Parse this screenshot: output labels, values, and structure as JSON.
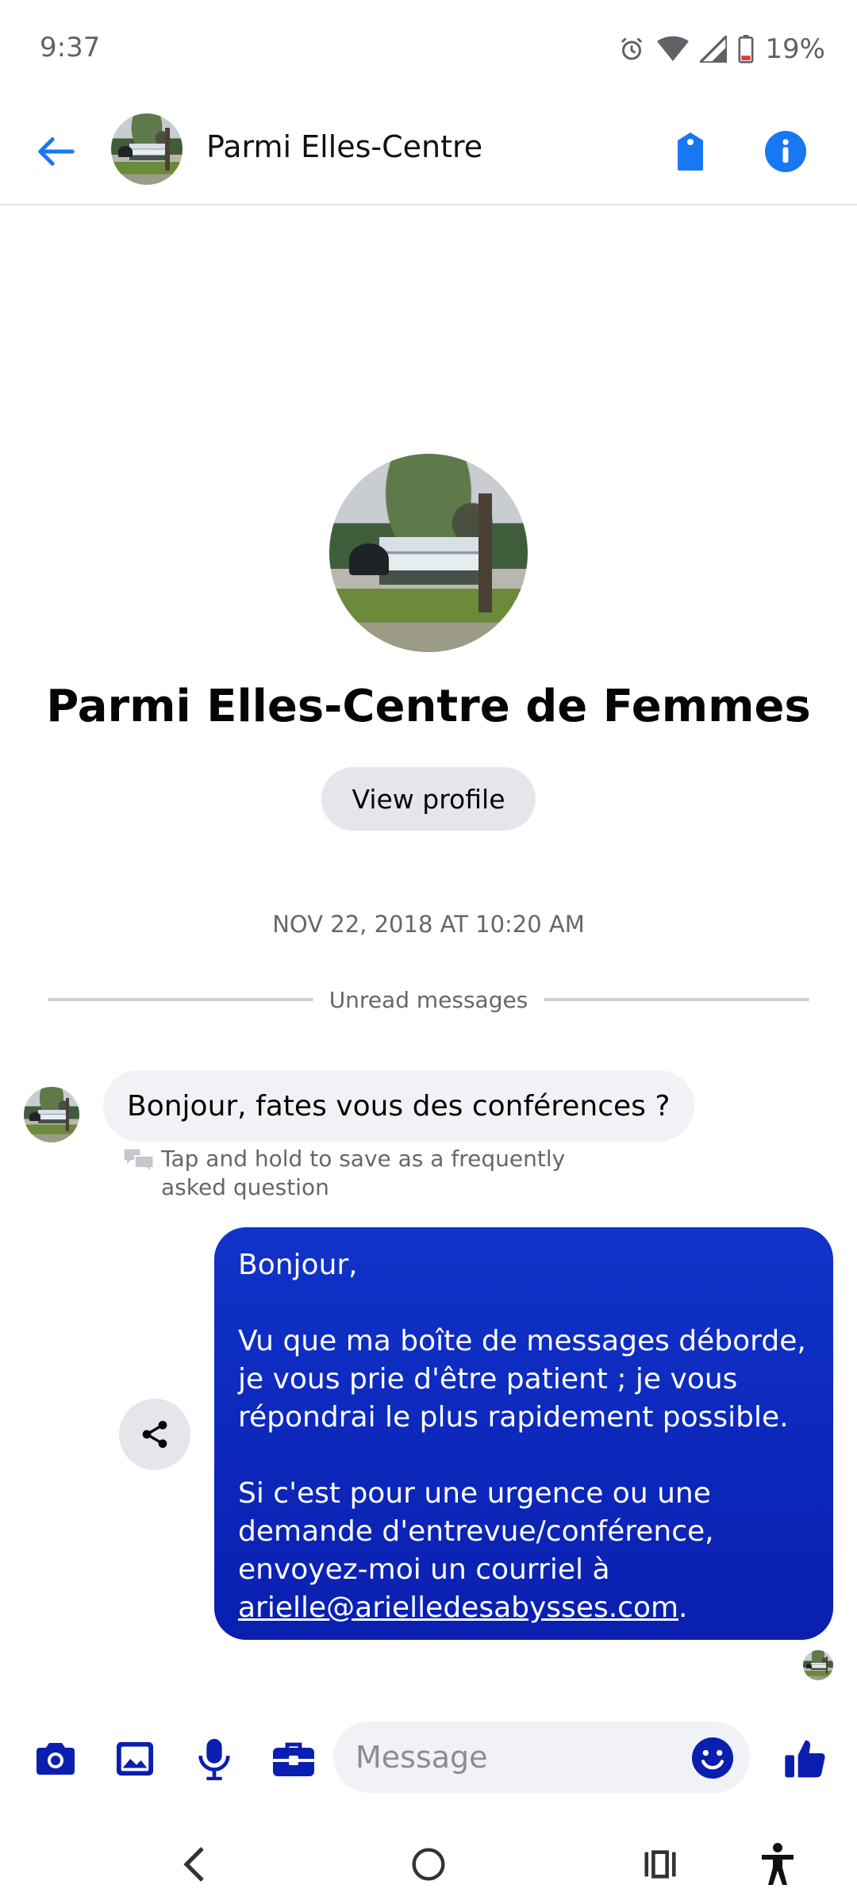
{
  "status_bar": {
    "time": "9:37",
    "battery": "19%"
  },
  "header": {
    "title": "Parmi Elles-Centre"
  },
  "profile": {
    "name": "Parmi Elles-Centre de Femmes",
    "view_profile_label": "View profile"
  },
  "conversation": {
    "timestamp": "NOV 22, 2018 AT 10:20 AM",
    "unread_label": "Unread messages",
    "incoming_message": "Bonjour, fates vous des conférences ?",
    "faq_hint": "Tap and hold to save as a frequently asked question",
    "outgoing_message": {
      "line1": "Bonjour,",
      "para2": "Vu que ma boîte de messages déborde, je vous prie d'être patient ; je vous répondrai le plus rapidement possible.",
      "para3_prefix": "Si c'est pour une urgence ou une demande d'entrevue/conférence, envoyez-moi un courriel à",
      "email": "arielle@arielledesabysses.com",
      "suffix": "."
    }
  },
  "composer": {
    "placeholder": "Message"
  },
  "colors": {
    "accent": "#0a1fb0",
    "header_blue": "#1877f2",
    "bubble_gray": "#f0f2f5"
  },
  "icons": [
    "back-arrow-icon",
    "tag-icon",
    "info-icon",
    "camera-icon",
    "gallery-icon",
    "microphone-icon",
    "briefcase-icon",
    "emoji-icon",
    "thumbs-up-icon",
    "share-icon",
    "nav-back-icon",
    "nav-home-icon",
    "nav-recents-icon",
    "accessibility-icon"
  ]
}
